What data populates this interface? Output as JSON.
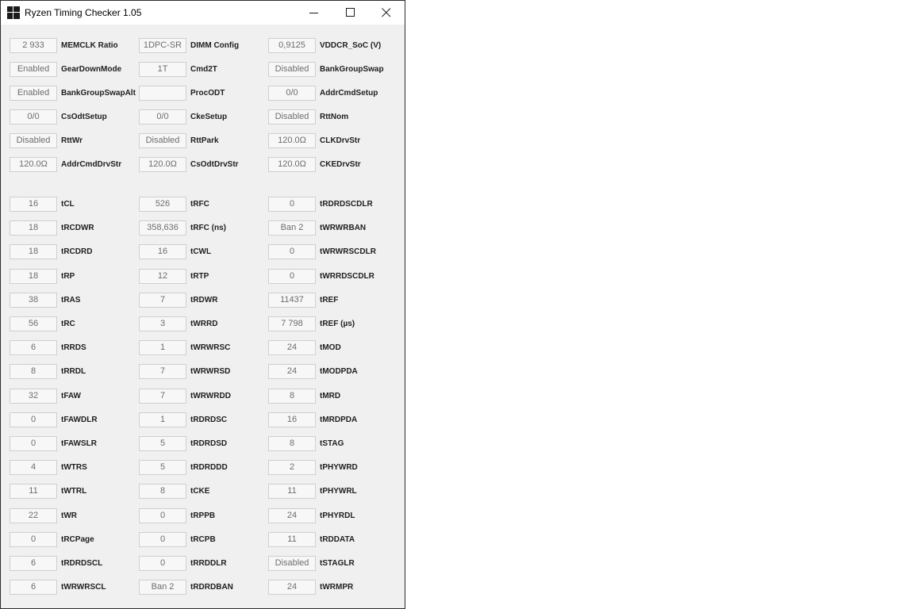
{
  "window": {
    "title": "Ryzen Timing Checker 1.05",
    "controls": {
      "minimize_icon": "minimize-icon",
      "maximize_icon": "maximize-icon",
      "close_icon": "close-icon"
    }
  },
  "config": {
    "rows": [
      [
        {
          "value": "2 933",
          "label": "MEMCLK Ratio"
        },
        {
          "value": "1DPC-SR",
          "label": "DIMM Config"
        },
        {
          "value": "0,9125",
          "label": "VDDCR_SoC (V)"
        }
      ],
      [
        {
          "value": "Enabled",
          "label": "GearDownMode"
        },
        {
          "value": "1T",
          "label": "Cmd2T"
        },
        {
          "value": "Disabled",
          "label": "BankGroupSwap"
        }
      ],
      [
        {
          "value": "Enabled",
          "label": "BankGroupSwapAlt"
        },
        {
          "value": "",
          "label": "ProcODT"
        },
        {
          "value": "0/0",
          "label": "AddrCmdSetup"
        }
      ],
      [
        {
          "value": "0/0",
          "label": "CsOdtSetup"
        },
        {
          "value": "0/0",
          "label": "CkeSetup"
        },
        {
          "value": "Disabled",
          "label": "RttNom"
        }
      ],
      [
        {
          "value": "Disabled",
          "label": "RttWr"
        },
        {
          "value": "Disabled",
          "label": "RttPark"
        },
        {
          "value": "120.0Ω",
          "label": "CLKDrvStr"
        }
      ],
      [
        {
          "value": "120.0Ω",
          "label": "AddrCmdDrvStr"
        },
        {
          "value": "120.0Ω",
          "label": "CsOdtDrvStr"
        },
        {
          "value": "120.0Ω",
          "label": "CKEDrvStr"
        }
      ]
    ]
  },
  "timings": {
    "rows": [
      [
        {
          "value": "16",
          "label": "tCL"
        },
        {
          "value": "526",
          "label": "tRFC"
        },
        {
          "value": "0",
          "label": "tRDRDSCDLR"
        }
      ],
      [
        {
          "value": "18",
          "label": "tRCDWR"
        },
        {
          "value": "358,636",
          "label": "tRFC (ns)"
        },
        {
          "value": "Ban 2",
          "label": "tWRWRBAN"
        }
      ],
      [
        {
          "value": "18",
          "label": "tRCDRD"
        },
        {
          "value": "16",
          "label": "tCWL"
        },
        {
          "value": "0",
          "label": "tWRWRSCDLR"
        }
      ],
      [
        {
          "value": "18",
          "label": "tRP"
        },
        {
          "value": "12",
          "label": "tRTP"
        },
        {
          "value": "0",
          "label": "tWRRDSCDLR"
        }
      ],
      [
        {
          "value": "38",
          "label": "tRAS"
        },
        {
          "value": "7",
          "label": "tRDWR"
        },
        {
          "value": "11437",
          "label": "tREF"
        }
      ],
      [
        {
          "value": "56",
          "label": "tRC"
        },
        {
          "value": "3",
          "label": "tWRRD"
        },
        {
          "value": "7 798",
          "label": "tREF (µs)"
        }
      ],
      [
        {
          "value": "6",
          "label": "tRRDS"
        },
        {
          "value": "1",
          "label": "tWRWRSC"
        },
        {
          "value": "24",
          "label": "tMOD"
        }
      ],
      [
        {
          "value": "8",
          "label": "tRRDL"
        },
        {
          "value": "7",
          "label": "tWRWRSD"
        },
        {
          "value": "24",
          "label": "tMODPDA"
        }
      ],
      [
        {
          "value": "32",
          "label": "tFAW"
        },
        {
          "value": "7",
          "label": "tWRWRDD"
        },
        {
          "value": "8",
          "label": "tMRD"
        }
      ],
      [
        {
          "value": "0",
          "label": "tFAWDLR"
        },
        {
          "value": "1",
          "label": "tRDRDSC"
        },
        {
          "value": "16",
          "label": "tMRDPDA"
        }
      ],
      [
        {
          "value": "0",
          "label": "tFAWSLR"
        },
        {
          "value": "5",
          "label": "tRDRDSD"
        },
        {
          "value": "8",
          "label": "tSTAG"
        }
      ],
      [
        {
          "value": "4",
          "label": "tWTRS"
        },
        {
          "value": "5",
          "label": "tRDRDDD"
        },
        {
          "value": "2",
          "label": "tPHYWRD"
        }
      ],
      [
        {
          "value": "11",
          "label": "tWTRL"
        },
        {
          "value": "8",
          "label": "tCKE"
        },
        {
          "value": "11",
          "label": "tPHYWRL"
        }
      ],
      [
        {
          "value": "22",
          "label": "tWR"
        },
        {
          "value": "0",
          "label": "tRPPB"
        },
        {
          "value": "24",
          "label": "tPHYRDL"
        }
      ],
      [
        {
          "value": "0",
          "label": "tRCPage"
        },
        {
          "value": "0",
          "label": "tRCPB"
        },
        {
          "value": "11",
          "label": "tRDDATA"
        }
      ],
      [
        {
          "value": "6",
          "label": "tRDRDSCL"
        },
        {
          "value": "0",
          "label": "tRRDDLR"
        },
        {
          "value": "Disabled",
          "label": "tSTAGLR"
        }
      ],
      [
        {
          "value": "6",
          "label": "tWRWRSCL"
        },
        {
          "value": "Ban 2",
          "label": "tRDRDBAN"
        },
        {
          "value": "24",
          "label": "tWRMPR"
        }
      ]
    ]
  }
}
